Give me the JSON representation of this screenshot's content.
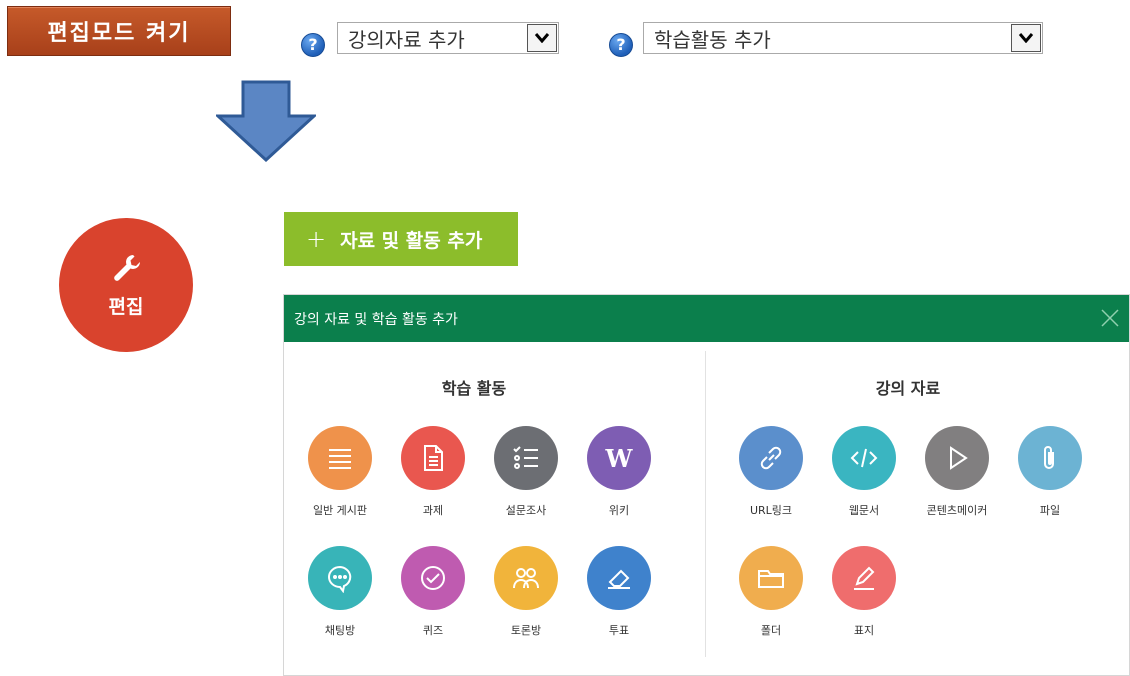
{
  "legacy_toolbar": {
    "edit_mode_label": "편집모드 켜기",
    "help_icon_glyph": "?",
    "resource_select_value": "강의자료 추가",
    "activity_select_value": "학습활동 추가"
  },
  "new_ui": {
    "edit_label": "편집",
    "add_button": {
      "plus": "+",
      "label": "자료 및 활동 추가"
    }
  },
  "modal": {
    "title": "강의 자료 및 학습 활동 추가",
    "activities": {
      "title": "학습 활동",
      "items": [
        {
          "label": "일반 게시판",
          "icon": "list-icon",
          "color": "#ef924b"
        },
        {
          "label": "과제",
          "icon": "document-icon",
          "color": "#e9574f"
        },
        {
          "label": "설문조사",
          "icon": "checklist-icon",
          "color": "#6c6e73"
        },
        {
          "label": "위키",
          "icon": "wiki-icon",
          "color": "#7e5db3"
        },
        {
          "label": "채팅방",
          "icon": "chat-bubble-icon",
          "color": "#38b4b8"
        },
        {
          "label": "퀴즈",
          "icon": "check-circle-icon",
          "color": "#bf5bb0"
        },
        {
          "label": "토론방",
          "icon": "people-icon",
          "color": "#f1b43b"
        },
        {
          "label": "투표",
          "icon": "eraser-icon",
          "color": "#3f82cc"
        }
      ]
    },
    "resources": {
      "title": "강의 자료",
      "items": [
        {
          "label": "URL링크",
          "icon": "link-icon",
          "color": "#5b8fcc"
        },
        {
          "label": "웹문서",
          "icon": "code-icon",
          "color": "#3ab5c1"
        },
        {
          "label": "콘텐츠메이커",
          "icon": "play-icon",
          "color": "#817f80"
        },
        {
          "label": "파일",
          "icon": "paperclip-icon",
          "color": "#6cb3d3"
        },
        {
          "label": "폴더",
          "icon": "folder-icon",
          "color": "#f0ad4e"
        },
        {
          "label": "표지",
          "icon": "pencil-icon",
          "color": "#ef6d6d"
        }
      ]
    }
  }
}
